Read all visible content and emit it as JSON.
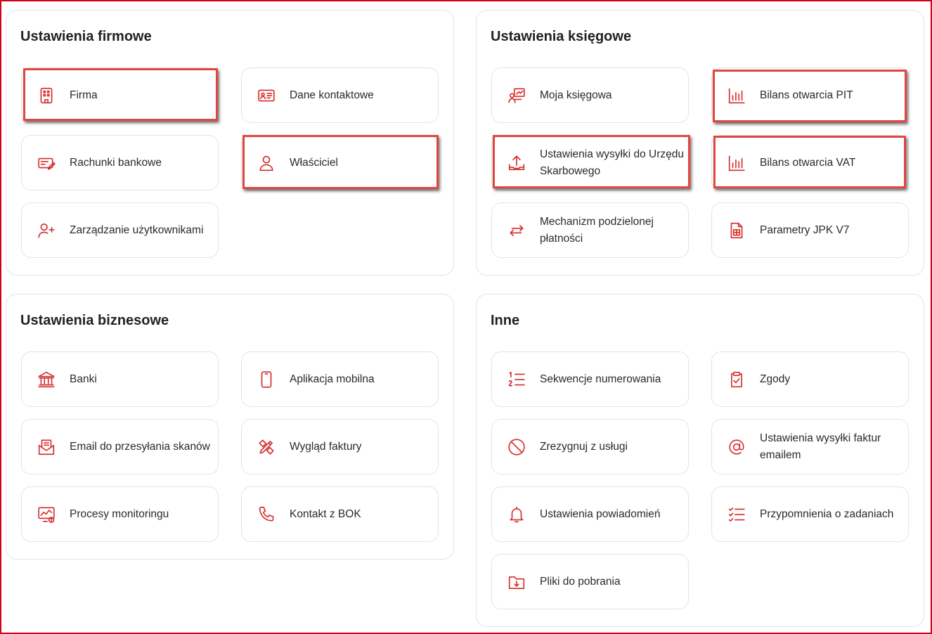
{
  "colors": {
    "accent": "#d62b2b",
    "frame": "#d0021b",
    "highlight": "#e2463f"
  },
  "sections": {
    "firmowe": {
      "title": "Ustawienia firmowe",
      "items": [
        {
          "label": "Firma",
          "icon": "building-icon"
        },
        {
          "label": "Dane kontaktowe",
          "icon": "contact-card-icon"
        },
        {
          "label": "Rachunki bankowe",
          "icon": "bank-account-icon"
        },
        {
          "label": "Właściciel",
          "icon": "user-icon"
        },
        {
          "label": "Zarządzanie użytkownikami",
          "icon": "add-user-icon"
        }
      ]
    },
    "ksiegowe": {
      "title": "Ustawienia księgowe",
      "items": [
        {
          "label": "Moja księgowa",
          "icon": "accountant-icon"
        },
        {
          "label": "Bilans otwarcia PIT",
          "icon": "bar-chart-icon"
        },
        {
          "label": "Ustawienia wysyłki do Urzędu Skarbowego",
          "icon": "upload-icon"
        },
        {
          "label": "Bilans otwarcia VAT",
          "icon": "bar-chart-icon"
        },
        {
          "label": "Mechanizm podzielonej płatności",
          "icon": "split-arrows-icon"
        },
        {
          "label": "Parametry JPK V7",
          "icon": "spreadsheet-doc-icon"
        }
      ]
    },
    "biznesowe": {
      "title": "Ustawienia biznesowe",
      "items": [
        {
          "label": "Banki",
          "icon": "bank-icon"
        },
        {
          "label": "Aplikacja mobilna",
          "icon": "smartphone-icon"
        },
        {
          "label": "Email do przesyłania skanów",
          "icon": "mail-scan-icon"
        },
        {
          "label": "Wygląd faktury",
          "icon": "design-tools-icon"
        },
        {
          "label": "Procesy monitoringu",
          "icon": "monitoring-icon"
        },
        {
          "label": "Kontakt z BOK",
          "icon": "phone-icon"
        }
      ]
    },
    "inne": {
      "title": "Inne",
      "items": [
        {
          "label": "Sekwencje numerowania",
          "icon": "numbered-list-icon"
        },
        {
          "label": "Zgody",
          "icon": "clipboard-check-icon"
        },
        {
          "label": "Zrezygnuj z usługi",
          "icon": "cancel-icon"
        },
        {
          "label": "Ustawienia wysyłki faktur emailem",
          "icon": "at-sign-icon"
        },
        {
          "label": "Ustawienia powiadomień",
          "icon": "bell-icon"
        },
        {
          "label": "Przypomnienia o zadaniach",
          "icon": "checklist-icon"
        },
        {
          "label": "Pliki do pobrania",
          "icon": "download-folder-icon"
        }
      ]
    }
  }
}
